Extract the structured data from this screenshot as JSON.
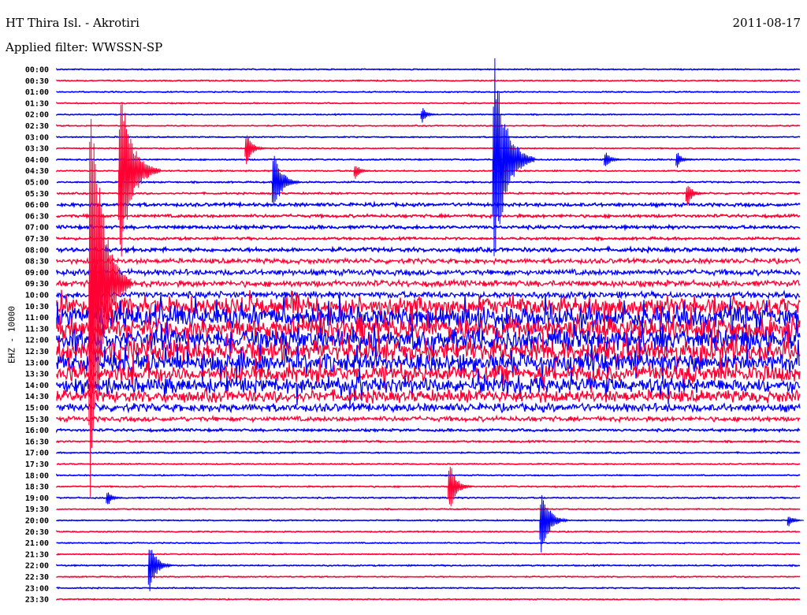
{
  "header": {
    "title": "HT Thira Isl. - Akrotiri",
    "filter": "Applied filter: WWSSN-SP",
    "date": "2011-08-17"
  },
  "chart_data": {
    "type": "line",
    "subtype": "helicorder seismogram",
    "title": "HT Thira Isl. - Akrotiri",
    "ylabel": "EHZ - 10000",
    "xlabel": "",
    "minutes_per_line": 30,
    "colors": [
      "#0000ff",
      "#ff0033"
    ],
    "row_labels": [
      "00:00",
      "00:30",
      "01:00",
      "01:30",
      "02:00",
      "02:30",
      "03:00",
      "03:30",
      "04:00",
      "04:30",
      "05:00",
      "05:30",
      "06:00",
      "06:30",
      "07:00",
      "07:30",
      "08:00",
      "08:30",
      "09:00",
      "09:30",
      "10:00",
      "10:30",
      "11:00",
      "11:30",
      "12:00",
      "12:30",
      "13:00",
      "13:30",
      "14:00",
      "14:30",
      "15:00",
      "15:30",
      "16:00",
      "16:30",
      "17:00",
      "17:30",
      "18:00",
      "18:30",
      "19:00",
      "19:30",
      "20:00",
      "20:30",
      "21:00",
      "21:30",
      "22:00",
      "22:30",
      "23:00",
      "23:30"
    ],
    "noise_level": [
      0.25,
      0.25,
      0.25,
      0.25,
      0.25,
      0.25,
      0.25,
      0.25,
      0.3,
      0.3,
      0.35,
      0.4,
      0.8,
      0.7,
      0.8,
      0.6,
      1.0,
      1.2,
      1.4,
      1.5,
      1.6,
      4.5,
      5,
      5,
      5,
      5,
      4.5,
      4,
      3.5,
      3,
      2,
      1.2,
      0.6,
      0.4,
      0.3,
      0.25,
      0.25,
      0.3,
      0.3,
      0.25,
      0.25,
      0.25,
      0.25,
      0.25,
      0.3,
      0.25,
      0.25,
      0.25
    ],
    "events": [
      {
        "row": 19,
        "minute": 1.3,
        "amplitude": 25
      },
      {
        "row": 9,
        "minute": 2.5,
        "amplitude": 10
      },
      {
        "row": 8,
        "minute": 17.6,
        "amplitude": 12
      },
      {
        "row": 4,
        "minute": 14.7,
        "amplitude": 1
      },
      {
        "row": 10,
        "minute": 8.7,
        "amplitude": 4
      },
      {
        "row": 8,
        "minute": 22.1,
        "amplitude": 1.2
      },
      {
        "row": 8,
        "minute": 25.0,
        "amplitude": 1
      },
      {
        "row": 9,
        "minute": 12.0,
        "amplitude": 1
      },
      {
        "row": 7,
        "minute": 7.6,
        "amplitude": 2
      },
      {
        "row": 11,
        "minute": 25.4,
        "amplitude": 1.5
      },
      {
        "row": 37,
        "minute": 15.8,
        "amplitude": 3
      },
      {
        "row": 38,
        "minute": 2.0,
        "amplitude": 1
      },
      {
        "row": 40,
        "minute": 19.5,
        "amplitude": 4
      },
      {
        "row": 40,
        "minute": 29.5,
        "amplitude": 0.8
      },
      {
        "row": 44,
        "minute": 3.7,
        "amplitude": 3
      }
    ]
  }
}
